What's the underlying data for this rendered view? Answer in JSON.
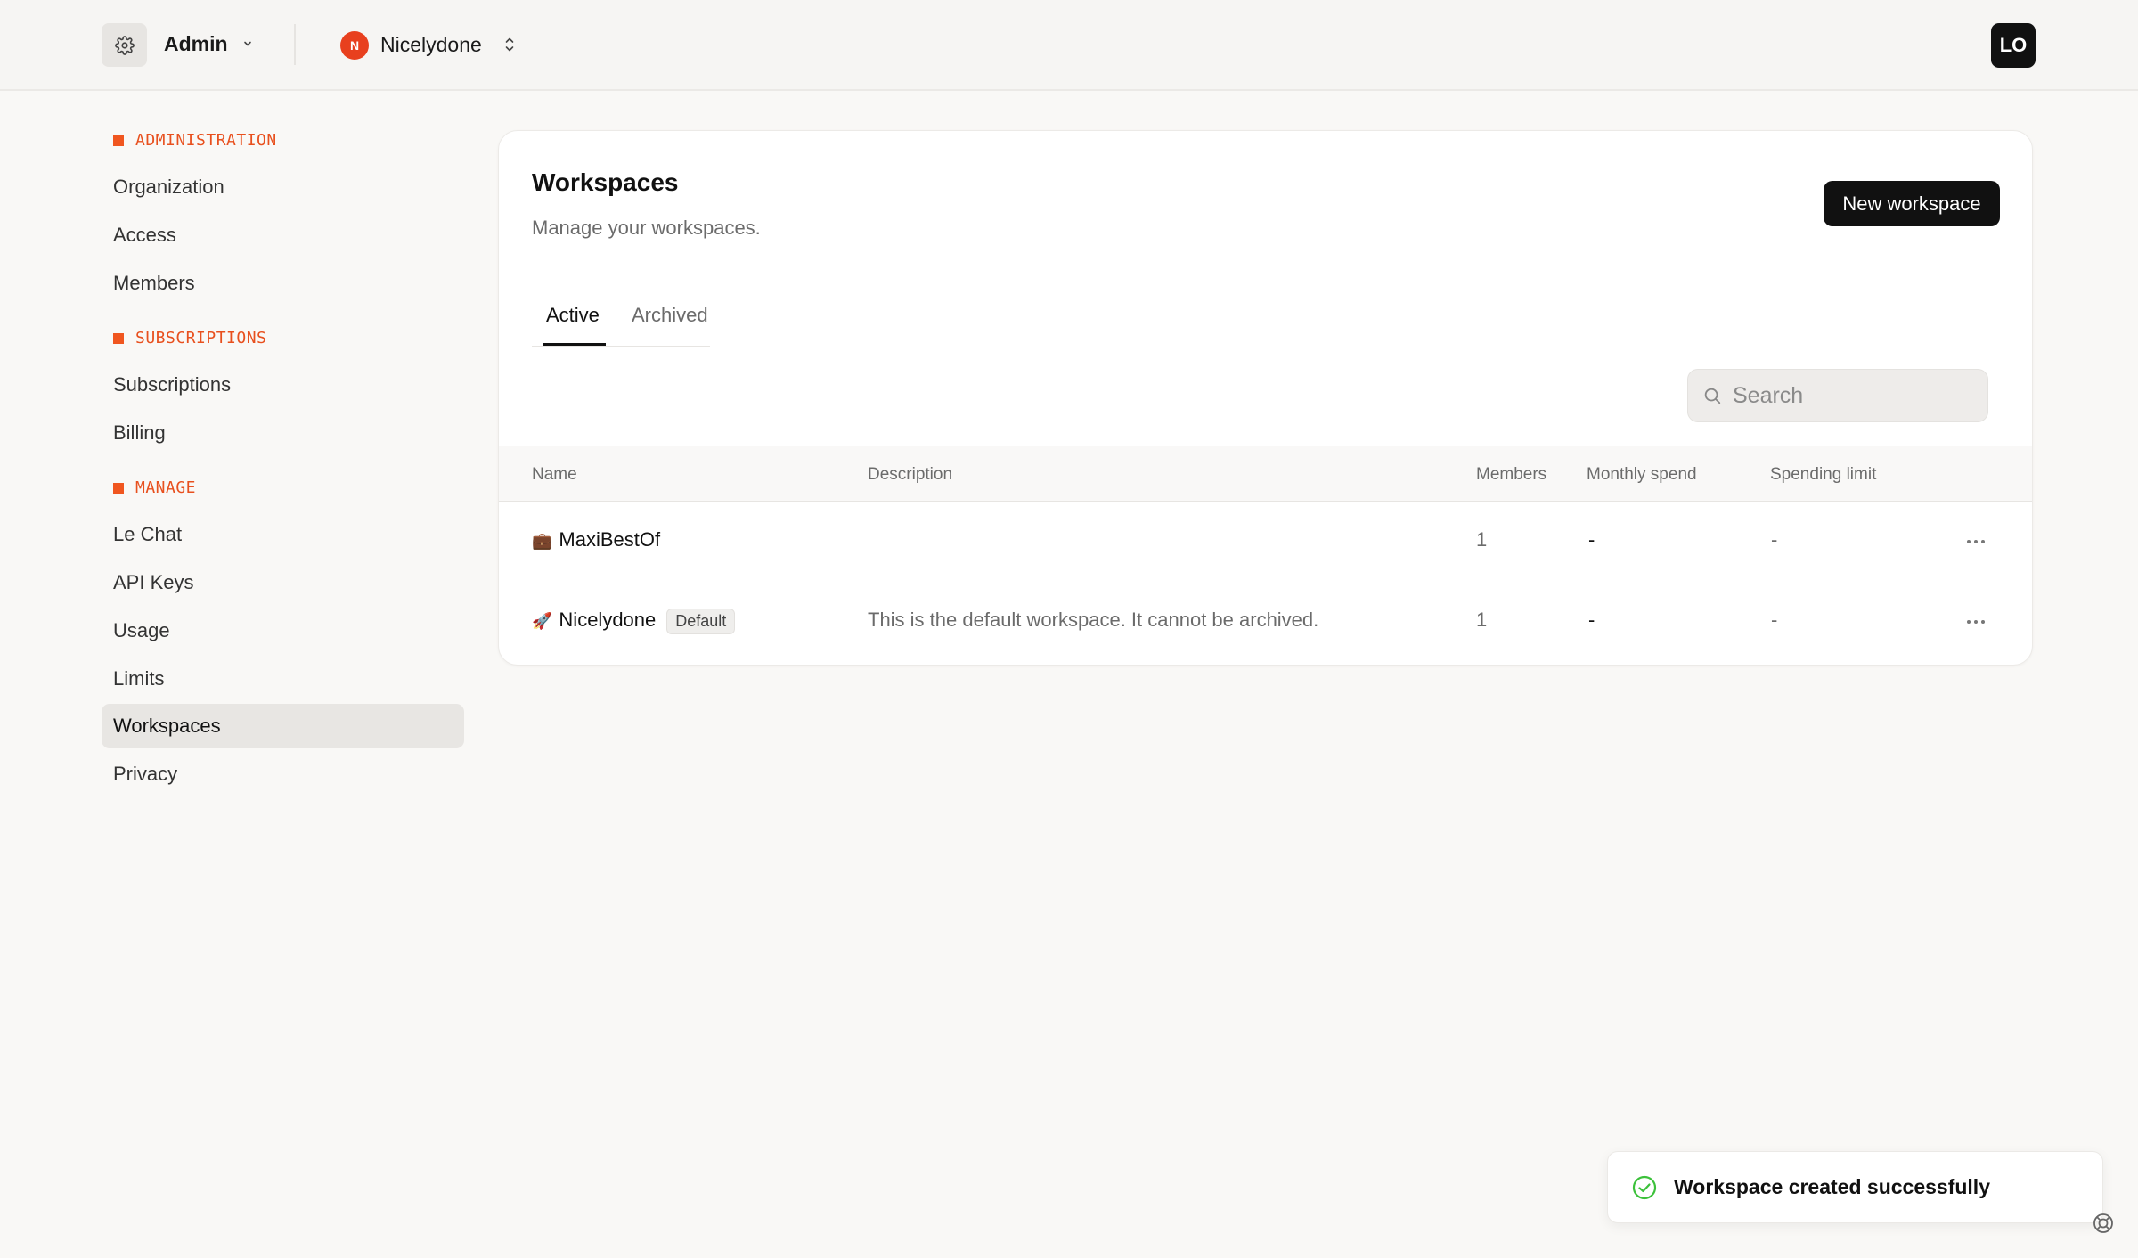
{
  "topbar": {
    "section_label": "Admin",
    "org_initial": "N",
    "org_name": "Nicelydone",
    "user_initials": "LO"
  },
  "sidebar": {
    "sections": [
      {
        "heading": "ADMINISTRATION",
        "items": [
          "Organization",
          "Access",
          "Members"
        ]
      },
      {
        "heading": "SUBSCRIPTIONS",
        "items": [
          "Subscriptions",
          "Billing"
        ]
      },
      {
        "heading": "MANAGE",
        "items": [
          "Le Chat",
          "API Keys",
          "Usage",
          "Limits",
          "Workspaces",
          "Privacy"
        ]
      }
    ],
    "active_item": "Workspaces"
  },
  "main": {
    "title": "Workspaces",
    "subtitle": "Manage your workspaces.",
    "new_button": "New workspace",
    "tabs": [
      {
        "label": "Active",
        "active": true
      },
      {
        "label": "Archived",
        "active": false
      }
    ],
    "search": {
      "placeholder": "Search",
      "value": ""
    },
    "columns": [
      "Name",
      "Description",
      "Members",
      "Monthly spend",
      "Spending limit"
    ],
    "rows": [
      {
        "emoji": "💼",
        "name": "MaxiBestOf",
        "badge": "",
        "description": "",
        "members": "1",
        "monthly_spend": "-",
        "spending_limit": "-"
      },
      {
        "emoji": "🚀",
        "name": "Nicelydone",
        "badge": "Default",
        "description": "This is the default workspace. It cannot be archived.",
        "members": "1",
        "monthly_spend": "-",
        "spending_limit": "-"
      }
    ]
  },
  "toast": {
    "message": "Workspace created successfully",
    "status_color": "#3cc13b"
  },
  "colors": {
    "accent": "#e8501e",
    "primary_button": "#111111"
  }
}
